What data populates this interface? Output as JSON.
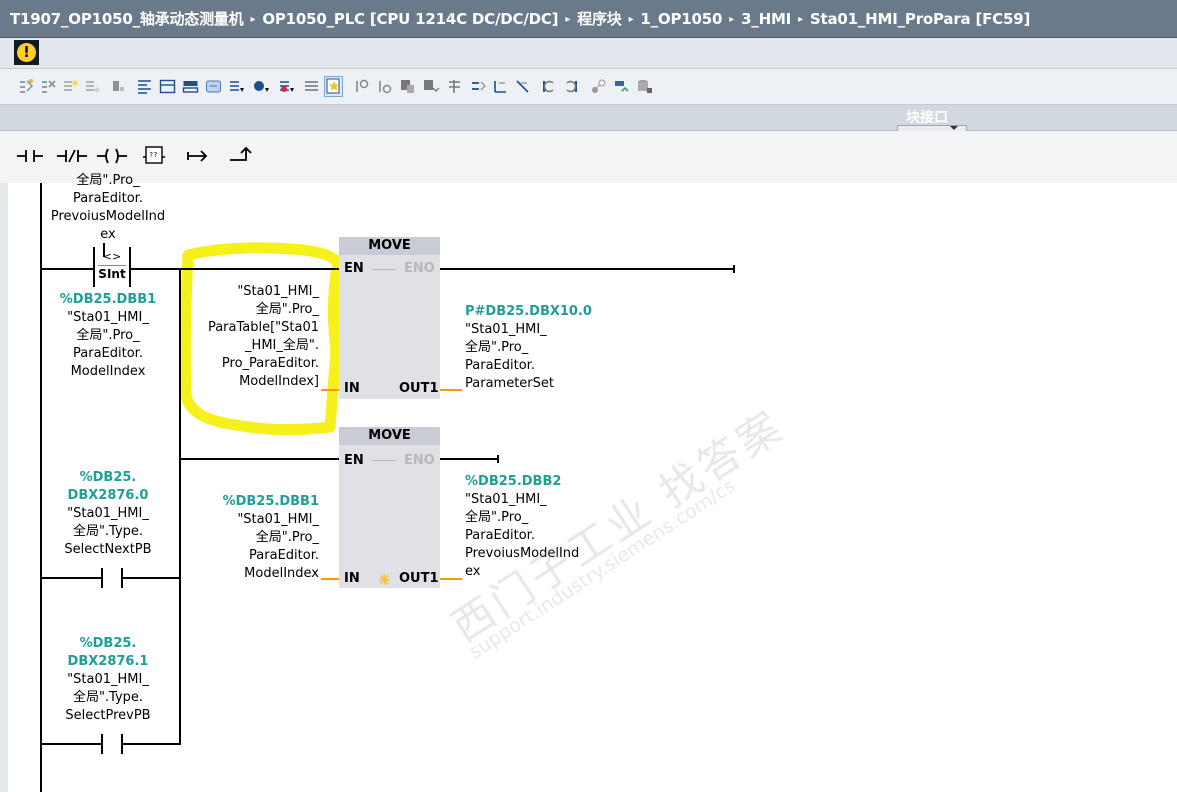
{
  "breadcrumb": {
    "items": [
      "T1907_OP1050_轴承动态测量机",
      "OP1050_PLC [CPU 1214C DC/DC/DC]",
      "程序块",
      "1_OP1050",
      "3_HMI",
      "Sta01_HMI_ProPara [FC59]"
    ],
    "separator": "▸"
  },
  "warning": {
    "glyph": "!",
    "icon": "warning-icon"
  },
  "interface_bar": {
    "label": "块接口"
  },
  "instructions": {
    "no_contact": "⊣⊢",
    "nc_contact": "⊣/⊢",
    "coil": "–( )–",
    "empty_box": "??",
    "branch_open": "↦",
    "branch_close": "⬏"
  },
  "ladder": {
    "top_partial": {
      "line1": "全局\".Pro_",
      "line2": "ParaEditor.",
      "line3": "PrevoiusModelInd",
      "line4": "ex"
    },
    "compare": {
      "op": "<>",
      "type": "SInt",
      "addr": "%DB25.DBB1",
      "line1": "\"Sta01_HMI_",
      "line2": "全局\".Pro_",
      "line3": "ParaEditor.",
      "line4": "ModelIndex"
    },
    "move1": {
      "title": "MOVE",
      "en": "EN",
      "eno": "ENO",
      "in": "IN",
      "out": "OUT1",
      "in_lines": [
        "\"Sta01_HMI_",
        "全局\".Pro_",
        "ParaTable[\"Sta01",
        "_HMI_全局\".",
        "Pro_ParaEditor.",
        "ModelIndex]"
      ],
      "out_addr": "P#DB25.DBX10.0",
      "out_lines": [
        "\"Sta01_HMI_",
        "全局\".Pro_",
        "ParaEditor.",
        "ParameterSet"
      ]
    },
    "move2": {
      "title": "MOVE",
      "en": "EN",
      "eno": "ENO",
      "in": "IN",
      "out": "OUT1",
      "in_addr": "%DB25.DBB1",
      "in_lines": [
        "\"Sta01_HMI_",
        "全局\".Pro_",
        "ParaEditor.",
        "ModelIndex"
      ],
      "out_addr": "%DB25.DBB2",
      "out_lines": [
        "\"Sta01_HMI_",
        "全局\".Pro_",
        "ParaEditor.",
        "PrevoiusModelInd",
        "ex"
      ]
    },
    "contact_next": {
      "addr1": "%DB25.",
      "addr2": "DBX2876.0",
      "line1": "\"Sta01_HMI_",
      "line2": "全局\".Type.",
      "line3": "SelectNextPB"
    },
    "contact_prev": {
      "addr1": "%DB25.",
      "addr2": "DBX2876.1",
      "line1": "\"Sta01_HMI_",
      "line2": "全局\".Type.",
      "line3": "SelectPrevPB"
    }
  },
  "watermark": {
    "cn": "西门子工业 找答案",
    "url": "support.industry.siemens.com/cs"
  },
  "colors": {
    "title_bg": "#6b7a8a",
    "address": "#1e9e96",
    "orange_wire": "#f39a00",
    "highlight": "#f8f21c",
    "box_bg": "#dfe1e6"
  }
}
